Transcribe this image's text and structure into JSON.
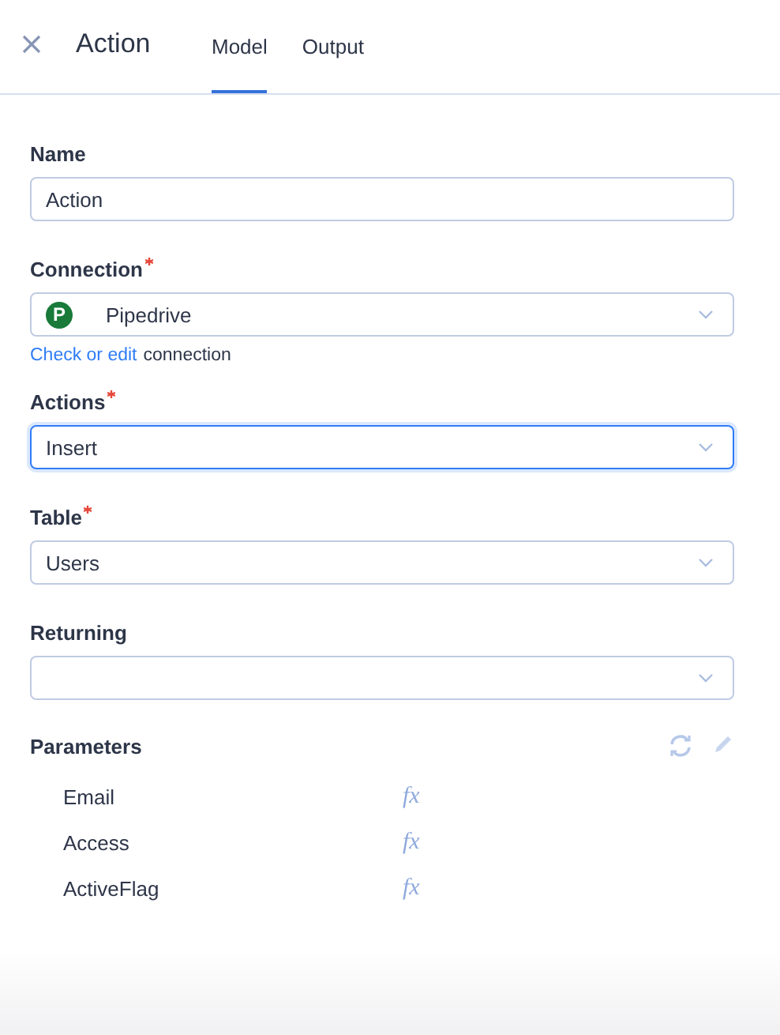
{
  "header": {
    "title": "Action",
    "tabs": [
      {
        "label": "Model",
        "selected": true
      },
      {
        "label": "Output",
        "selected": false
      }
    ]
  },
  "fields": [
    {
      "kind": "text",
      "label": "Name",
      "required": false,
      "value": "Action",
      "focused": false
    },
    {
      "kind": "select",
      "label": "Connection",
      "required": true,
      "value": "Pipedrive",
      "focused": false,
      "logo": "P",
      "link": "Check or edit",
      "link_suffix": "connection"
    },
    {
      "kind": "select",
      "label": "Actions",
      "required": true,
      "value": "Insert",
      "focused": true
    },
    {
      "kind": "select",
      "label": "Table",
      "required": true,
      "value": "Users",
      "focused": false
    },
    {
      "kind": "select",
      "label": "Returning",
      "required": false,
      "focused": false
    }
  ],
  "parameters": {
    "title": "Parameters",
    "items": [
      {
        "name": "Email",
        "fx": "fx"
      },
      {
        "name": "Access",
        "fx": "fx"
      },
      {
        "name": "ActiveFlag",
        "fx": "fx"
      }
    ]
  }
}
